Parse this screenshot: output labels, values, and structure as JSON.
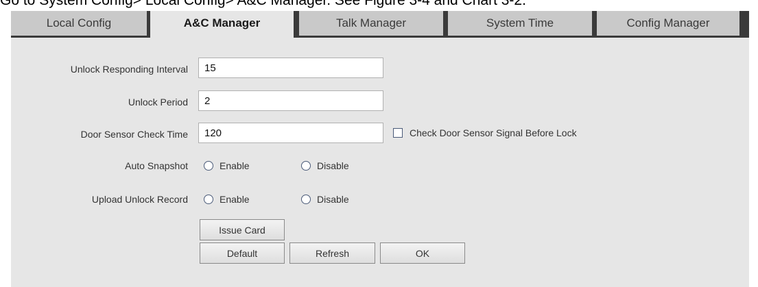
{
  "caption": "Go to System Config> Local Config> A&C Manager. See Figure 3-4 and Chart 3-2.",
  "tabs": [
    {
      "label": "Local Config",
      "active": false
    },
    {
      "label": "A&C Manager",
      "active": true
    },
    {
      "label": "Talk Manager",
      "active": false
    },
    {
      "label": "System Time",
      "active": false
    },
    {
      "label": "Config Manager",
      "active": false
    }
  ],
  "form": {
    "unlock_responding_interval": {
      "label": "Unlock Responding Interval",
      "value": "15"
    },
    "unlock_period": {
      "label": "Unlock Period",
      "value": "2"
    },
    "door_sensor_check_time": {
      "label": "Door Sensor Check Time",
      "value": "120"
    },
    "check_door_sensor": {
      "label": "Check Door Sensor Signal Before Lock",
      "checked": false
    },
    "auto_snapshot": {
      "label": "Auto Snapshot",
      "enable": "Enable",
      "disable": "Disable"
    },
    "upload_unlock_record": {
      "label": "Upload Unlock Record",
      "enable": "Enable",
      "disable": "Disable"
    }
  },
  "buttons": {
    "issue_card": "Issue Card",
    "default": "Default",
    "refresh": "Refresh",
    "ok": "OK"
  },
  "colors": {
    "tab_bar": "#3a3a3a",
    "tab_inactive": "#c9c9c9",
    "panel": "#e6e6e6"
  }
}
